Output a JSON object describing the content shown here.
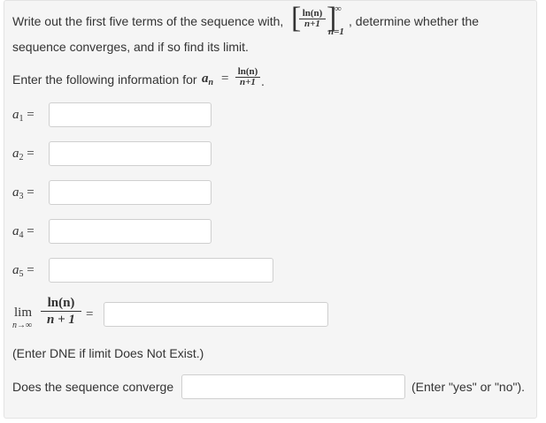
{
  "intro": {
    "before": "Write out the first five terms of the sequence with,",
    "seq_num": "ln(n)",
    "seq_den": "n+1",
    "sup": "∞",
    "sub": "n=1",
    "after": ", determine whether the",
    "line2": "sequence converges, and if so find its limit."
  },
  "instruction": {
    "text": "Enter the following information for",
    "an": "a",
    "an_sub": "n",
    "eq": "=",
    "num": "ln(n)",
    "den": "n+1",
    "period": "."
  },
  "terms": [
    {
      "letter": "a",
      "index": "1",
      "eq": "=",
      "value": ""
    },
    {
      "letter": "a",
      "index": "2",
      "eq": "=",
      "value": ""
    },
    {
      "letter": "a",
      "index": "3",
      "eq": "=",
      "value": ""
    },
    {
      "letter": "a",
      "index": "4",
      "eq": "=",
      "value": ""
    },
    {
      "letter": "a",
      "index": "5",
      "eq": "=",
      "value": ""
    }
  ],
  "limit": {
    "lim": "lim",
    "under": "n→∞",
    "num": "ln(n)",
    "den": "n + 1",
    "eq": "=",
    "value": ""
  },
  "dne_note": "(Enter DNE if limit Does Not Exist.)",
  "converge": {
    "label": "Does the sequence converge",
    "value": "",
    "hint": "(Enter \"yes\" or \"no\")."
  }
}
